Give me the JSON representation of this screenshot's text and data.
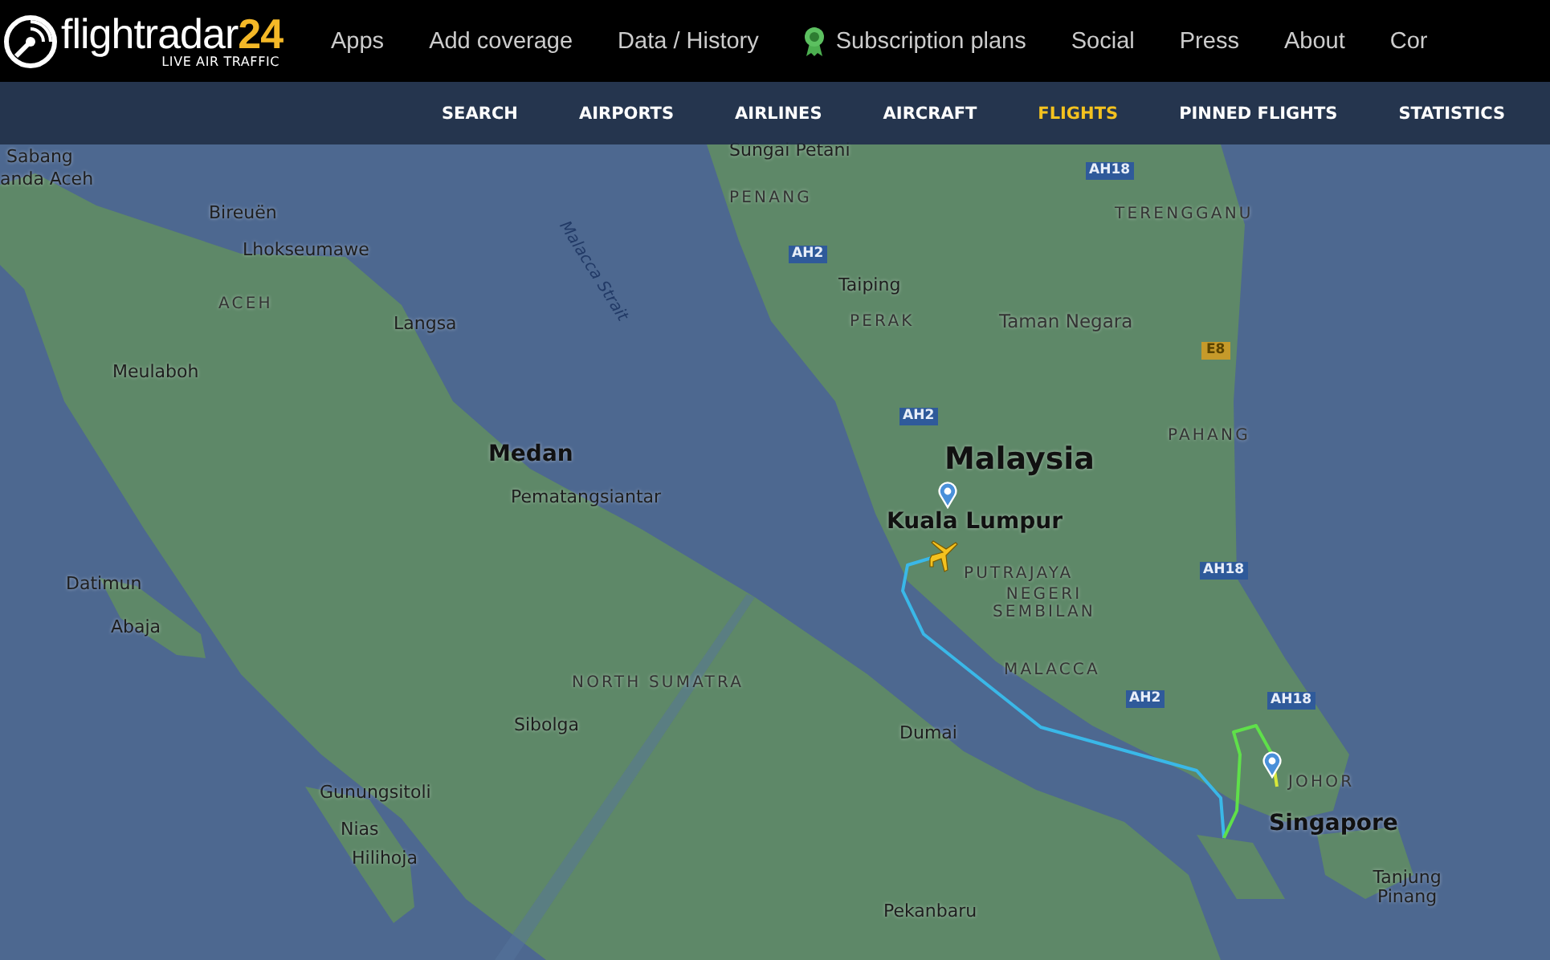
{
  "header": {
    "logo": {
      "name": "flightradar",
      "number": "24",
      "tagline": "LIVE AIR TRAFFIC"
    },
    "menu": [
      {
        "label": "Apps",
        "kind": "plain"
      },
      {
        "label": "Add coverage",
        "kind": "plain"
      },
      {
        "label": "Data / History",
        "kind": "plain"
      },
      {
        "label": "Subscription plans",
        "kind": "badge"
      },
      {
        "label": "Social",
        "kind": "plain"
      },
      {
        "label": "Press",
        "kind": "plain"
      },
      {
        "label": "About",
        "kind": "plain"
      },
      {
        "label": "Cor",
        "kind": "plain"
      }
    ]
  },
  "subnav": [
    {
      "label": "SEARCH",
      "selected": false
    },
    {
      "label": "AIRPORTS",
      "selected": false
    },
    {
      "label": "AIRLINES",
      "selected": false
    },
    {
      "label": "AIRCRAFT",
      "selected": false
    },
    {
      "label": "FLIGHTS",
      "selected": true
    },
    {
      "label": "PINNED FLIGHTS",
      "selected": false
    },
    {
      "label": "STATISTICS",
      "selected": false
    }
  ],
  "map": {
    "labels": [
      {
        "text": "Sabang",
        "kind": "city"
      },
      {
        "text": "anda Aceh",
        "kind": "city"
      },
      {
        "text": "Bireuën",
        "kind": "city"
      },
      {
        "text": "Lhokseumawe",
        "kind": "city"
      },
      {
        "text": "ACEH",
        "kind": "region"
      },
      {
        "text": "Langsa",
        "kind": "city"
      },
      {
        "text": "Meulaboh",
        "kind": "city"
      },
      {
        "text": "Malacca Strait",
        "kind": "water"
      },
      {
        "text": "Medan",
        "kind": "major"
      },
      {
        "text": "Pematangsiantar",
        "kind": "city"
      },
      {
        "text": "Datimun",
        "kind": "city"
      },
      {
        "text": "Abaja",
        "kind": "city"
      },
      {
        "text": "NORTH SUMATRA",
        "kind": "region"
      },
      {
        "text": "Sibolga",
        "kind": "city"
      },
      {
        "text": "Gunungsitoli",
        "kind": "city"
      },
      {
        "text": "Nias",
        "kind": "city"
      },
      {
        "text": "Hilihoja",
        "kind": "city"
      },
      {
        "text": "Sungai Petani",
        "kind": "city"
      },
      {
        "text": "PENANG",
        "kind": "region"
      },
      {
        "text": "AH2",
        "kind": "road"
      },
      {
        "text": "Taiping",
        "kind": "city"
      },
      {
        "text": "PERAK",
        "kind": "region"
      },
      {
        "text": "AH18",
        "kind": "road"
      },
      {
        "text": "TERENGGANU",
        "kind": "region"
      },
      {
        "text": "Taman Negara",
        "kind": "park"
      },
      {
        "text": "E8",
        "kind": "expressway"
      },
      {
        "text": "AH2",
        "kind": "road"
      },
      {
        "text": "Malaysia",
        "kind": "country"
      },
      {
        "text": "PAHANG",
        "kind": "region"
      },
      {
        "text": "Kuala Lumpur",
        "kind": "major"
      },
      {
        "text": "PUTRAJAYA",
        "kind": "region"
      },
      {
        "text": "NEGERI SEMBILAN",
        "kind": "region"
      },
      {
        "text": "AH18",
        "kind": "road"
      },
      {
        "text": "MALACCA",
        "kind": "region"
      },
      {
        "text": "AH2",
        "kind": "road"
      },
      {
        "text": "AH18",
        "kind": "road"
      },
      {
        "text": "Dumai",
        "kind": "city"
      },
      {
        "text": "JOHOR",
        "kind": "region"
      },
      {
        "text": "Singapore",
        "kind": "major"
      },
      {
        "text": "Tanjung Pinang",
        "kind": "city"
      },
      {
        "text": "Pekanbaru",
        "kind": "city"
      }
    ]
  }
}
